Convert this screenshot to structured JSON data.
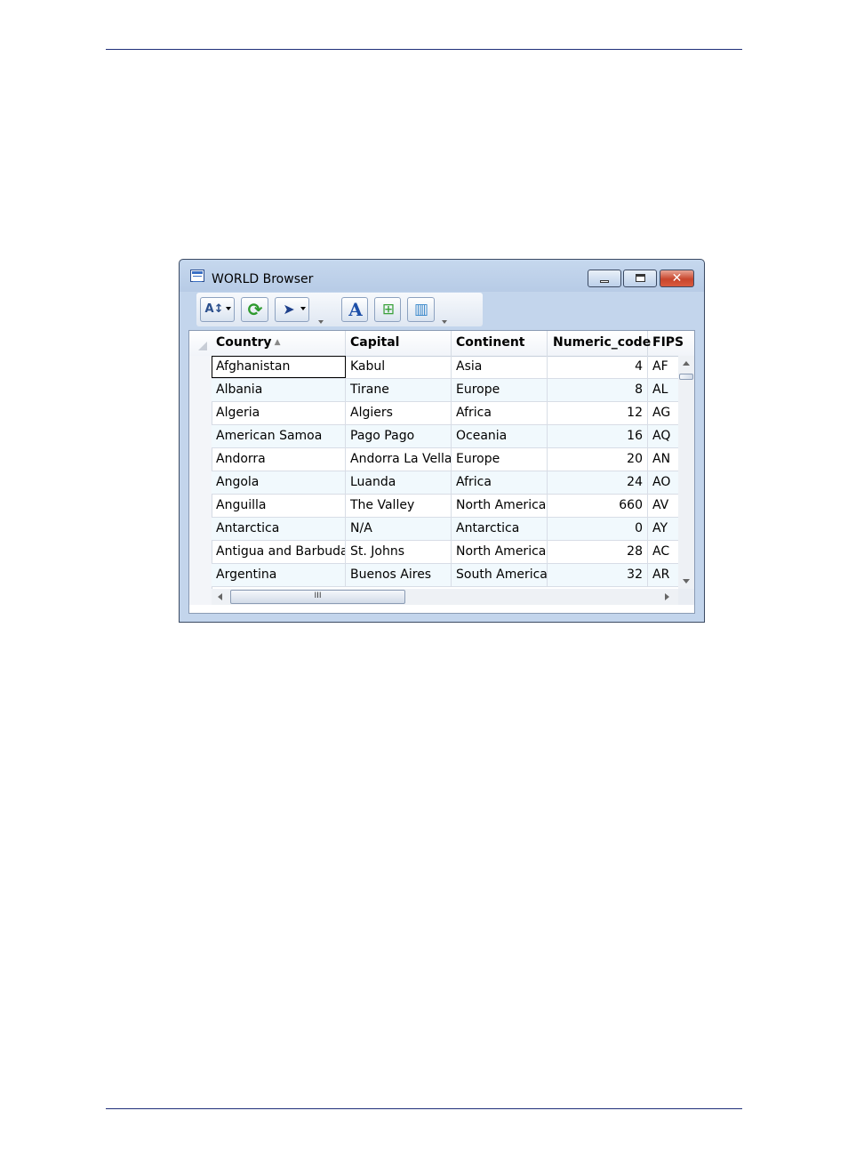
{
  "window": {
    "title": "WORLD Browser",
    "close_glyph": "✕"
  },
  "toolbar": {
    "buttons": [
      {
        "name": "sort-filter",
        "icon": "A↕"
      },
      {
        "name": "refresh",
        "icon": "⟳"
      },
      {
        "name": "select",
        "icon": "➤"
      },
      {
        "name": "font",
        "icon": "A"
      },
      {
        "name": "add-row",
        "icon": "⊞"
      },
      {
        "name": "columns",
        "icon": "▥"
      }
    ]
  },
  "grid": {
    "columns": [
      "Country",
      "Capital",
      "Continent",
      "Numeric_code",
      "FIPS"
    ],
    "sort_indicator": "▲",
    "rows": [
      [
        "Afghanistan",
        "Kabul",
        "Asia",
        "4",
        "AF"
      ],
      [
        "Albania",
        "Tirane",
        "Europe",
        "8",
        "AL"
      ],
      [
        "Algeria",
        "Algiers",
        "Africa",
        "12",
        "AG"
      ],
      [
        "American Samoa",
        "Pago Pago",
        "Oceania",
        "16",
        "AQ"
      ],
      [
        "Andorra",
        "Andorra La Vella",
        "Europe",
        "20",
        "AN"
      ],
      [
        "Angola",
        "Luanda",
        "Africa",
        "24",
        "AO"
      ],
      [
        "Anguilla",
        "The Valley",
        "North America",
        "660",
        "AV"
      ],
      [
        "Antarctica",
        "N/A",
        "Antarctica",
        "0",
        "AY"
      ],
      [
        "Antigua and Barbuda",
        "St. Johns",
        "North America",
        "28",
        "AC"
      ],
      [
        "Argentina",
        "Buenos Aires",
        "South America",
        "32",
        "AR"
      ]
    ],
    "scroll_grip": "III"
  }
}
